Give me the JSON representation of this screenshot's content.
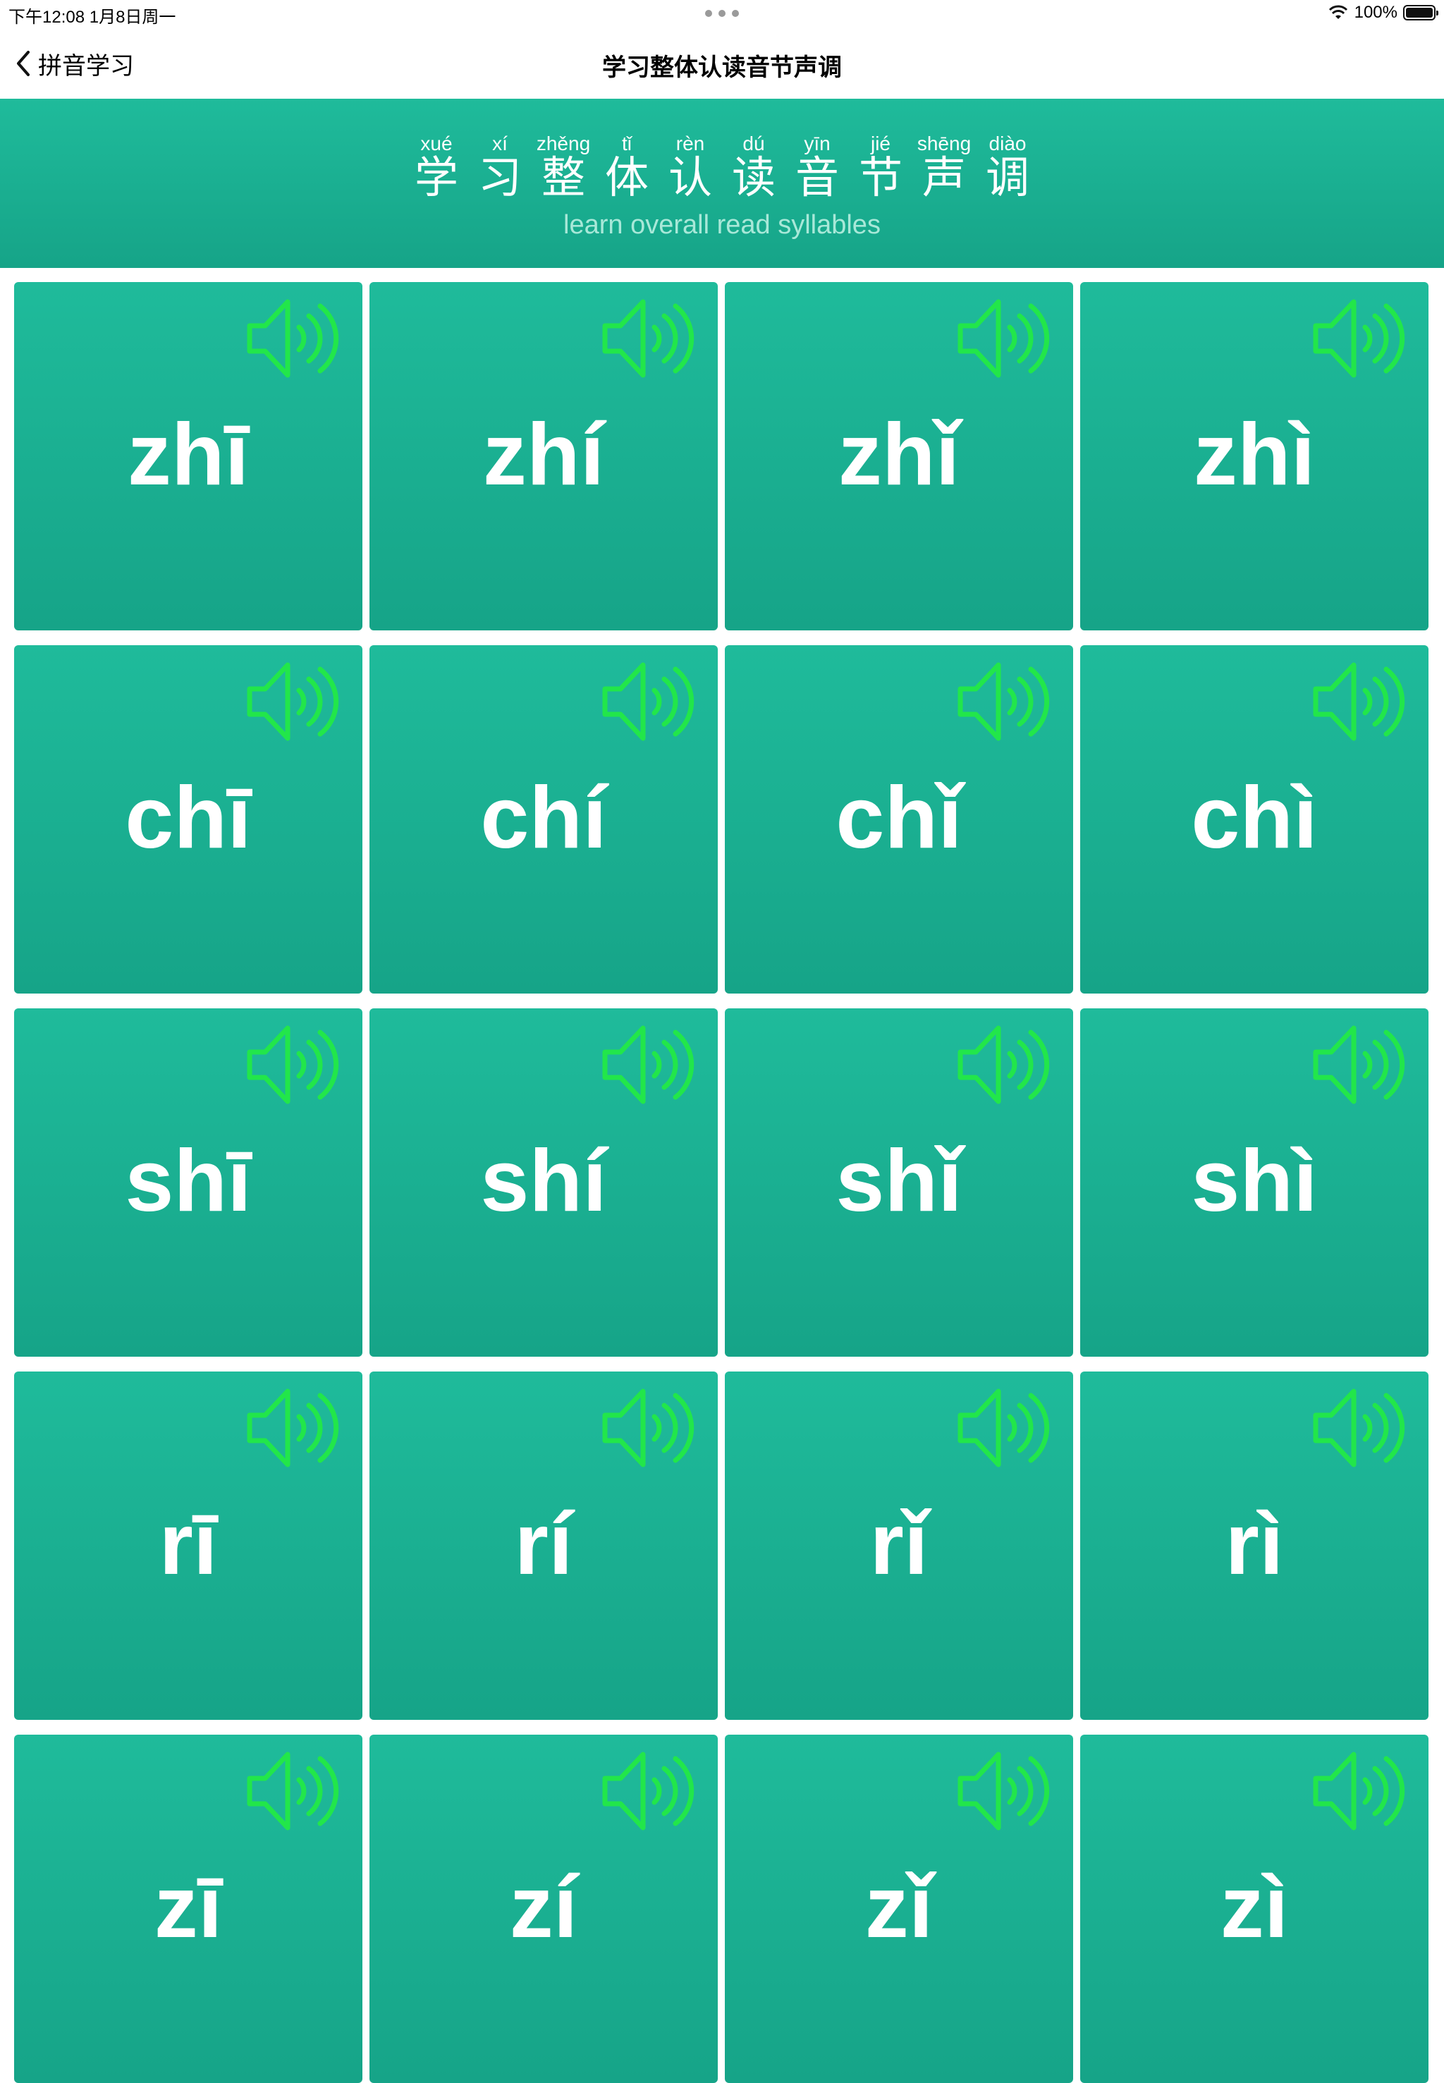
{
  "status_bar": {
    "time": "下午12:08   1月8日周一",
    "battery": "100%",
    "battery_level": 1.0,
    "wifi_icon": "wifi-icon"
  },
  "nav": {
    "back_label": "拼音学习",
    "back_icon": "chevron-left-icon",
    "title": "学习整体认读音节声调"
  },
  "banner": {
    "title_chars": [
      {
        "cn": "学",
        "py": "xué"
      },
      {
        "cn": "习",
        "py": "xí"
      },
      {
        "cn": "整",
        "py": "zhěng"
      },
      {
        "cn": "体",
        "py": "tǐ"
      },
      {
        "cn": "认",
        "py": "rèn"
      },
      {
        "cn": "读",
        "py": "dú"
      },
      {
        "cn": "音",
        "py": "yīn"
      },
      {
        "cn": "节",
        "py": "jié"
      },
      {
        "cn": "声",
        "py": "shēng"
      },
      {
        "cn": "调",
        "py": "diào"
      }
    ],
    "subtitle": "learn overall read syllables"
  },
  "cards": [
    "zhī",
    "zhí",
    "zhǐ",
    "zhì",
    "chī",
    "chí",
    "chǐ",
    "chì",
    "shī",
    "shí",
    "shǐ",
    "shì",
    "rī",
    "rí",
    "rǐ",
    "rì",
    "zī",
    "zí",
    "zǐ",
    "zì"
  ],
  "colors": {
    "card_top": "#1fbb9b",
    "card_bottom": "#16a488",
    "speaker": "#22e64a",
    "subtitle": "#a8e8d8"
  },
  "icons": {
    "card_icon": "speaker-icon"
  }
}
